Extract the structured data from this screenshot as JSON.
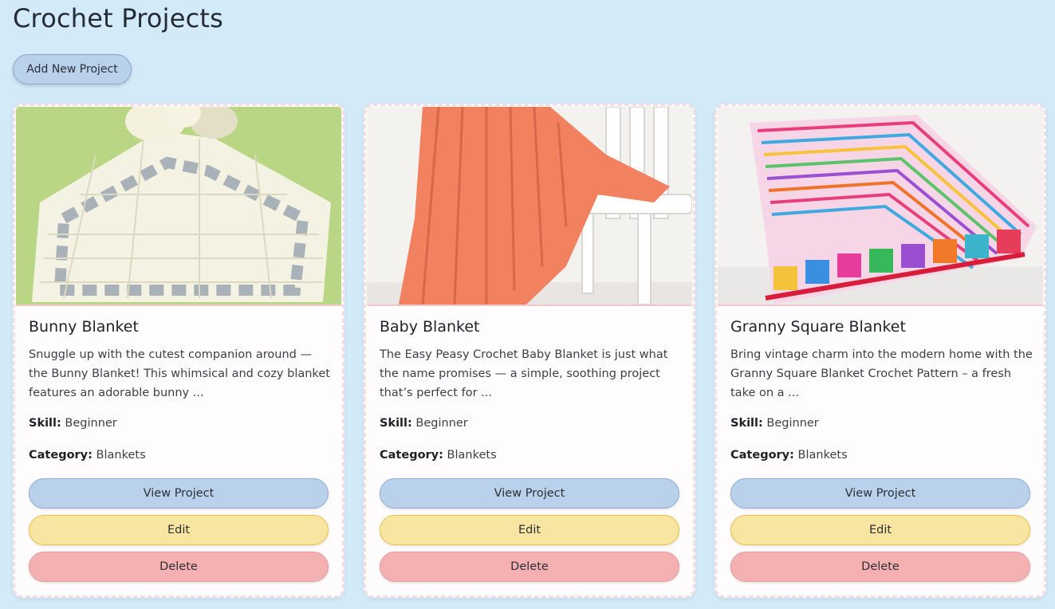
{
  "page": {
    "title": "Crochet Projects",
    "add_button": "Add New Project"
  },
  "labels": {
    "skill": "Skill:",
    "category": "Category:"
  },
  "projects": [
    {
      "title": "Bunny Blanket",
      "description": "Snuggle up with the cutest companion around — the Bunny Blanket! This whimsical and cozy blanket features an adorable bunny ...",
      "skill": "Beginner",
      "category": "Blankets",
      "view_label": "View Project",
      "edit_label": "Edit",
      "delete_label": "Delete",
      "image_alt": "cream granny square bunny lovey"
    },
    {
      "title": "Baby Blanket",
      "description": "The Easy Peasy Crochet Baby Blanket is just what the name promises — a simple, soothing project that’s perfect for ...",
      "skill": "Beginner",
      "category": "Blankets",
      "view_label": "View Project",
      "edit_label": "Edit",
      "delete_label": "Delete",
      "image_alt": "coral blanket draped on white chair"
    },
    {
      "title": "Granny Square Blanket",
      "description": "Bring vintage charm into the modern home with the Granny Square Blanket Crochet Pattern – a fresh take on a ...",
      "skill": "Beginner",
      "category": "Blankets",
      "view_label": "View Project",
      "edit_label": "Edit",
      "delete_label": "Delete",
      "image_alt": "rainbow granny square blanket"
    }
  ],
  "colors": {
    "background": "#d3eaf8",
    "view_button": "#bad1eb",
    "edit_button": "#f8e5a2",
    "delete_button": "#f5b1b2",
    "card_border": "#f3dde3"
  }
}
